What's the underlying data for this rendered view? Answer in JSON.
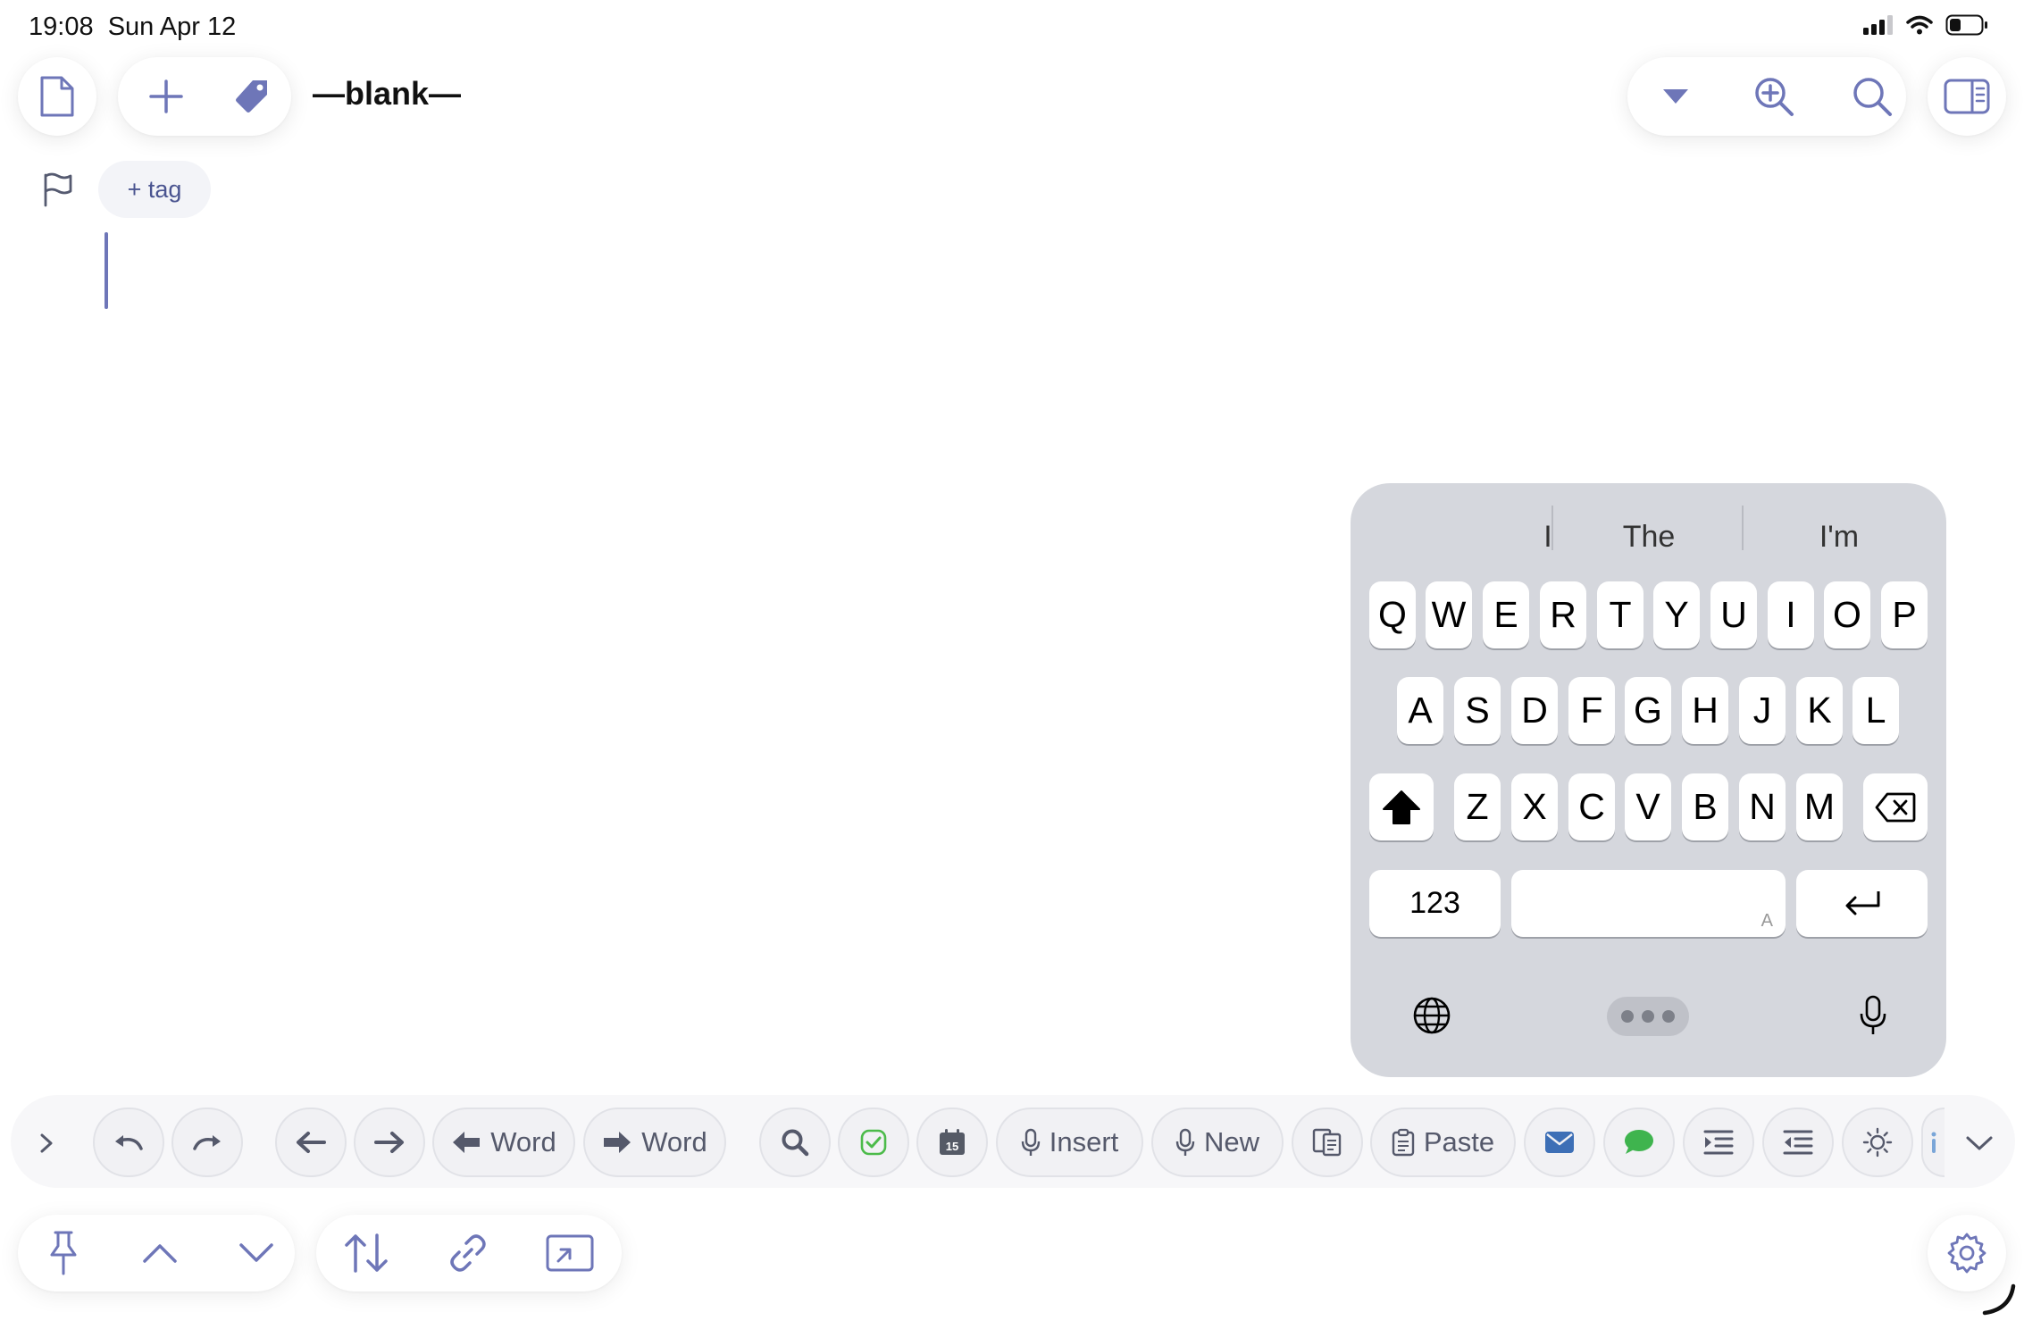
{
  "status": {
    "time": "19:08",
    "date": "Sun Apr 12"
  },
  "header": {
    "title": "—blank—",
    "left_icons": [
      "document-icon",
      "plus-icon",
      "tag-icon"
    ],
    "right_icons": [
      "dropdown-icon",
      "zoom-in-icon",
      "search-icon",
      "sidebar-icon"
    ]
  },
  "tags": {
    "flag_icon": "flag-icon",
    "add_tag_label": "+ tag"
  },
  "keyboard": {
    "suggestions": [
      "I",
      "The",
      "I'm"
    ],
    "row1": [
      "Q",
      "W",
      "E",
      "R",
      "T",
      "Y",
      "U",
      "I",
      "O",
      "P"
    ],
    "row2": [
      "A",
      "S",
      "D",
      "F",
      "G",
      "H",
      "J",
      "K",
      "L"
    ],
    "row3": [
      "Z",
      "X",
      "C",
      "V",
      "B",
      "N",
      "M"
    ],
    "numbers_key": "123",
    "space_hint": "A"
  },
  "toolbar": {
    "word_left_label": "Word",
    "word_right_label": "Word",
    "insert_label": "Insert",
    "new_label": "New",
    "paste_label": "Paste",
    "calendar_day": "15"
  },
  "bottom_bar": {
    "left_icons": [
      "pin-icon",
      "chevron-up-icon",
      "chevron-down-icon"
    ],
    "middle_icons": [
      "sort-icon",
      "link-icon",
      "open-window-icon"
    ],
    "right_icon": "settings-icon"
  },
  "colors": {
    "accent": "#6e76b8",
    "keyboard_bg": "#d5d7dd",
    "toolbar_bg": "#f7f7f9",
    "check_green": "#4cbb4a",
    "mail_blue": "#3d6fb6",
    "message_green": "#3fb44e"
  }
}
